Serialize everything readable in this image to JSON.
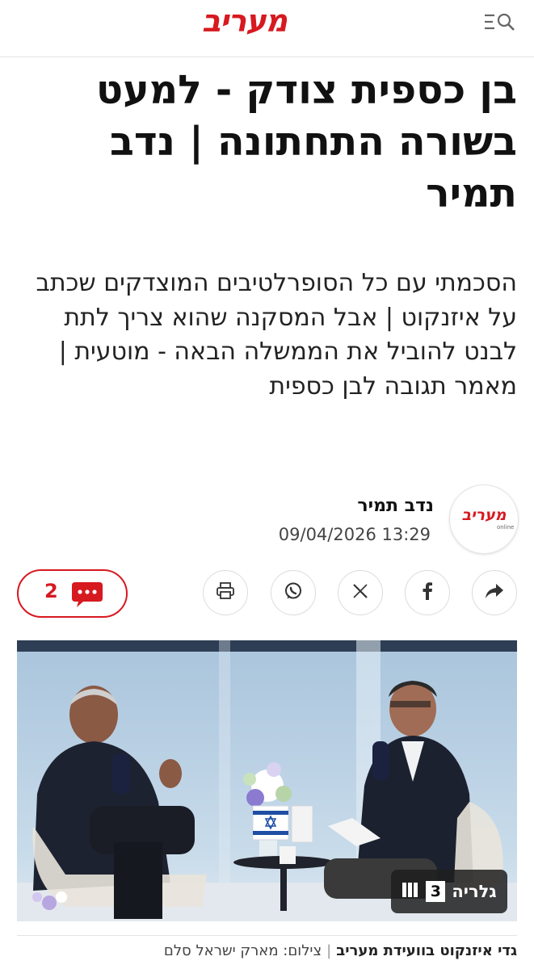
{
  "header": {
    "logo_text": "מעריב",
    "menu_icon": "menu-search-icon",
    "brand_color": "#d71920"
  },
  "article": {
    "headline": "בן כספית צודק - למעט בשורה התחתונה | נדב תמיר",
    "subtitle": "הסכמתי עם כל הסופרלטיבים המוצדקים שכתב על איזנקוט | אבל המסקנה שהוא צריך לתת לבנט להוביל את הממשלה הבאה - מוטעית | מאמר תגובה לבן כספית"
  },
  "author": {
    "avatar_logo": "מעריב",
    "avatar_sub": "online",
    "name": "נדב תמיר",
    "datetime": "09/04/2026 13:29"
  },
  "actions": {
    "comments_count": "2",
    "buttons": [
      "print-icon",
      "whatsapp-icon",
      "x-icon",
      "facebook-icon",
      "share-icon"
    ]
  },
  "photo": {
    "gallery_count": "3",
    "gallery_label": "גלריה"
  },
  "caption": {
    "title": "גדי איזנקוט בוועידת מעריב",
    "separator": "|",
    "credit": "צילום: מארק ישראל סלם"
  }
}
